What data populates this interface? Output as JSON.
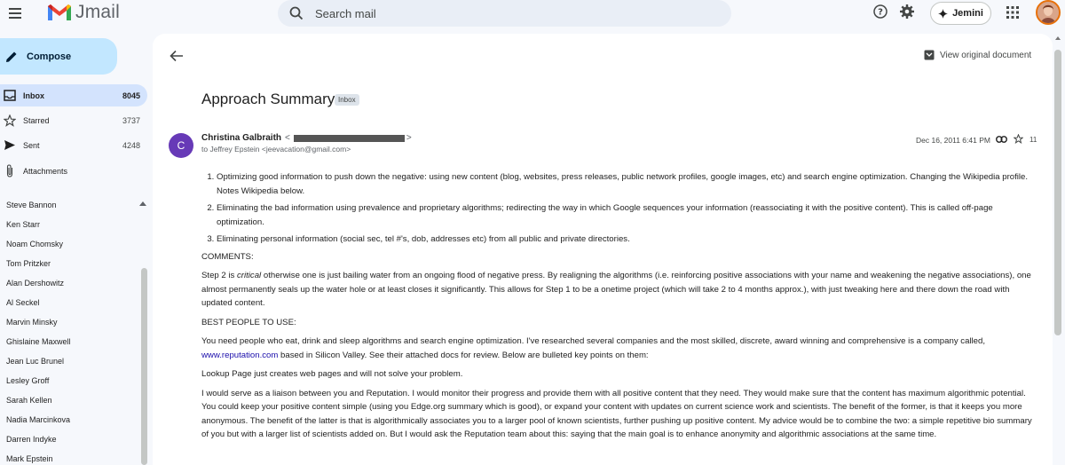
{
  "app": {
    "name": "Jmail",
    "colors": {
      "accent": "#c2e7ff",
      "active_nav": "#d3e3fd",
      "avatar": "#673ab7",
      "link": "#1a0dab"
    }
  },
  "search": {
    "placeholder": "Search mail"
  },
  "header": {
    "assistant_label": "Jemini"
  },
  "sidebar": {
    "compose_label": "Compose",
    "nav": [
      {
        "label": "Inbox",
        "count": "8045",
        "icon": "inbox-icon"
      },
      {
        "label": "Starred",
        "count": "3737",
        "icon": "star-icon"
      },
      {
        "label": "Sent",
        "count": "4248",
        "icon": "send-icon"
      },
      {
        "label": "Attachments",
        "count": "",
        "icon": "paperclip-icon"
      }
    ],
    "contacts": [
      "Steve Bannon",
      "Ken Starr",
      "Noam Chomsky",
      "Tom Pritzker",
      "Alan Dershowitz",
      "Al Seckel",
      "Marvin Minsky",
      "Ghislaine Maxwell",
      "Jean Luc Brunel",
      "Lesley Groff",
      "Sarah Kellen",
      "Nadia Marcinkova",
      "Darren Indyke",
      "Mark Epstein"
    ]
  },
  "email": {
    "view_original": "View original document",
    "subject": "Approach Summary",
    "tag": "Inbox",
    "sender_initial": "C",
    "sender_name": "Christina Galbraith",
    "to_line": "to Jeffrey Epstein <jeevacation@gmail.com>",
    "date": "Dec 16, 2011 6:41 PM",
    "attachment_count": "11",
    "list": [
      "Optimizing good information to push down the negative: using new content (blog, websites, press releases, public network profiles, google images, etc) and search engine optimization. Changing the Wikipedia profile. Notes Wikipedia below.",
      "Eliminating the bad information using prevalence and proprietary algorithms; redirecting the way in which Google sequences your information (reassociating it with the positive content). This is called off-page optimization.",
      "Eliminating personal information (social sec, tel #'s, dob, addresses etc) from all public and private directories."
    ],
    "comments_heading": "COMMENTS:",
    "comments_pre": "Step 2 is ",
    "comments_em": "critical",
    "comments_post": " otherwise one is just bailing water from an ongoing flood of negative press. By realigning the algorithms (i.e. reinforcing positive associations with your name and weakening the negative associations), one almost permanently seals up the water hole or at least closes it significantly. This allows for Step 1 to be a onetime project (which will take 2 to 4 months approx.), with just tweaking here and there down the road with updated content.",
    "best_heading": "BEST PEOPLE TO USE:",
    "best_pre": "You need people who eat, drink and sleep algorithms and search engine optimization. I've researched several companies and the most skilled, discrete, award winning and comprehensive is a company called, ",
    "best_link": "www.reputation.com",
    "best_post": " based in Silicon Valley. See their attached docs for review. Below are bulleted key points on them:",
    "lookup": "Lookup Page just creates web pages and will not solve your problem.",
    "liaison": "I would serve as a liaison between you and Reputation. I would monitor their progress and provide them with all positive content that they need. They would make sure that the content has maximum algorithmic potential. You could keep your positive content simple (using you Edge.org summary which is good), or expand your content with updates on current science work and scientists. The benefit of the former, is that it keeps you more anonymous. The benefit of the latter is that is algorithmically associates you to a larger pool of known scientists, further pushing up positive content. My advice would be to combine the two: a simple repetitive bio summary of you but with a larger list of scientists added on. But I would ask the Reputation team about this: saying that the main goal is to enhance anonymity and algorithmic associations at the same time."
  }
}
